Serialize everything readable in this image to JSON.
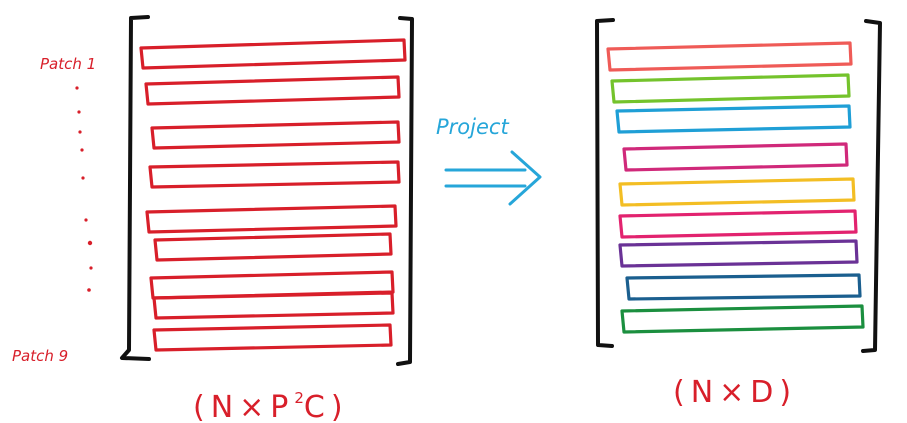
{
  "left_matrix": {
    "top_label": "Patch 1",
    "bottom_label": "Patch 9",
    "dimension_prefix": "(N×P",
    "dimension_exponent": "2",
    "dimension_suffix": "C)",
    "row_color": "#d81f2a",
    "row_count": 9
  },
  "arrow": {
    "label": "Project",
    "color": "#26a6d9"
  },
  "right_matrix": {
    "dimension_label": "(N×D)",
    "row_colors": [
      "#ef5b57",
      "#74c32c",
      "#1f9fd6",
      "#d0297a",
      "#f3be24",
      "#e2236f",
      "#6a3296",
      "#1b5f8f",
      "#1b8f3f"
    ]
  },
  "colors": {
    "bracket": "#111111",
    "dots": "#d81f2a"
  }
}
